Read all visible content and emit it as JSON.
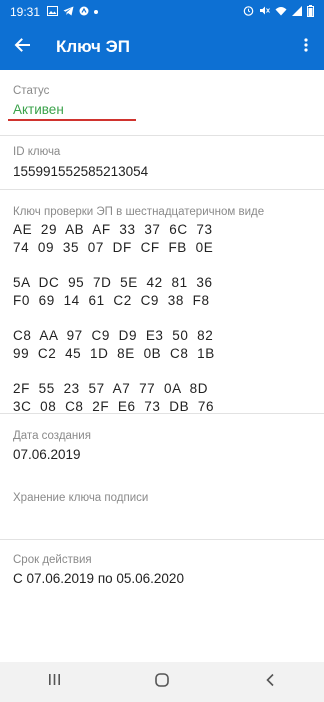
{
  "status_bar": {
    "time": "19:31",
    "left_icons": [
      "image-icon",
      "telegram-icon",
      "shield-icon",
      "dot-icon"
    ],
    "right_icons": [
      "alarm-icon",
      "mute-icon",
      "wifi-icon",
      "signal-icon",
      "battery-icon"
    ]
  },
  "app_bar": {
    "title": "Ключ ЭП",
    "back_icon": "arrow-back-icon",
    "menu_icon": "more-vert-icon"
  },
  "status": {
    "label": "Статус",
    "value": "Активен",
    "value_color": "#3aa24a",
    "underline_color": "#d0332e"
  },
  "key_id": {
    "label": "ID ключа",
    "value": "155991552585213054"
  },
  "hex_key": {
    "label": "Ключ проверки ЭП в шестнадцатеричном виде",
    "groups": [
      [
        "AE  29  AB  AF  33  37  6C  73",
        "74  09  35  07  DF  CF  FB  0E"
      ],
      [
        "5A  DC  95  7D  5E  42  81  36",
        "F0  69  14  61  C2  C9  38  F8"
      ],
      [
        "C8  AA  97  C9  D9  E3  50  82",
        "99  C2  45  1D  8E  0B  C8  1B"
      ],
      [
        "2F  55  23  57  A7  77  0A  8D",
        "3C  08  C8  2F  E6  73  DB  76"
      ]
    ]
  },
  "created": {
    "label": "Дата создания",
    "value": "07.06.2019"
  },
  "storage": {
    "label": "Хранение ключа подписи",
    "value": ""
  },
  "validity": {
    "label": "Срок действия",
    "value": "С 07.06.2019 по 05.06.2020"
  },
  "colors": {
    "primary": "#0d70d3",
    "accent_green": "#3aa24a",
    "accent_red": "#d0332e"
  },
  "nav_bar": {
    "icons": [
      "recents-icon",
      "home-icon",
      "back-icon"
    ]
  }
}
